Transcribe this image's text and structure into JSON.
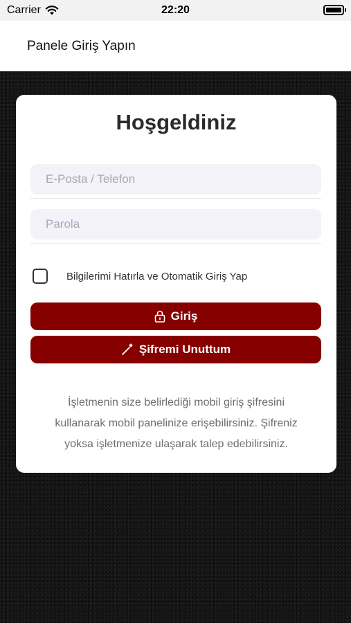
{
  "status_bar": {
    "carrier": "Carrier",
    "time": "22:20"
  },
  "navbar": {
    "title": "Panele Giriş Yapın"
  },
  "card": {
    "title": "Hoşgeldiniz",
    "email_placeholder": "E-Posta / Telefon",
    "email_value": "",
    "password_placeholder": "Parola",
    "password_value": "",
    "remember_label": "Bilgilerimi Hatırla ve Otomatik Giriş Yap",
    "remember_checked": false,
    "login_label": "Giriş",
    "forgot_label": "Şifremi Unuttum",
    "info_text": "İşletmenin size belirlediği mobil giriş şifresini kullanarak mobil panelinize erişebilirsiniz. Şifreniz yoksa işletmenize ulaşarak talep edebilirsiniz."
  },
  "colors": {
    "accent": "#860000",
    "input_bg": "#f3f2f8",
    "background": "#141414"
  },
  "icons": {
    "login": "lock-icon",
    "forgot": "magic-wand-icon",
    "wifi": "wifi-icon",
    "battery": "battery-icon"
  }
}
